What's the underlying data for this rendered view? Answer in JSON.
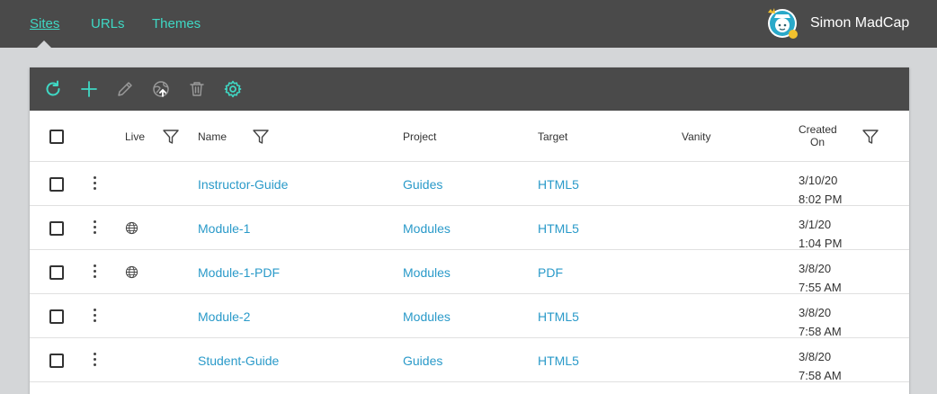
{
  "nav": {
    "tabs": [
      {
        "label": "Sites",
        "active": true
      },
      {
        "label": "URLs",
        "active": false
      },
      {
        "label": "Themes",
        "active": false
      }
    ]
  },
  "user": {
    "name": "Simon MadCap"
  },
  "toolbar": {
    "icons": [
      "refresh-icon",
      "add-icon",
      "edit-icon",
      "publish-icon",
      "delete-icon",
      "settings-icon"
    ]
  },
  "table": {
    "headers": {
      "live": "Live",
      "name": "Name",
      "project": "Project",
      "target": "Target",
      "vanity": "Vanity",
      "created_line1": "Created",
      "created_line2": "On"
    },
    "rows": [
      {
        "live": false,
        "name": "Instructor-Guide",
        "project": "Guides",
        "target": "HTML5",
        "vanity": "",
        "date": "3/10/20",
        "time": "8:02 PM"
      },
      {
        "live": true,
        "name": "Module-1",
        "project": "Modules",
        "target": "HTML5",
        "vanity": "",
        "date": "3/1/20",
        "time": "1:04 PM"
      },
      {
        "live": true,
        "name": "Module-1-PDF",
        "project": "Modules",
        "target": "PDF",
        "vanity": "",
        "date": "3/8/20",
        "time": "7:55 AM"
      },
      {
        "live": false,
        "name": "Module-2",
        "project": "Modules",
        "target": "HTML5",
        "vanity": "",
        "date": "3/8/20",
        "time": "7:58 AM"
      },
      {
        "live": false,
        "name": "Student-Guide",
        "project": "Guides",
        "target": "HTML5",
        "vanity": "",
        "date": "3/8/20",
        "time": "7:58 AM"
      }
    ]
  },
  "colors": {
    "bar": "#4a4a4a",
    "accent": "#3fd8c4",
    "link": "#2a9ac9",
    "background": "#d4d6d8"
  }
}
